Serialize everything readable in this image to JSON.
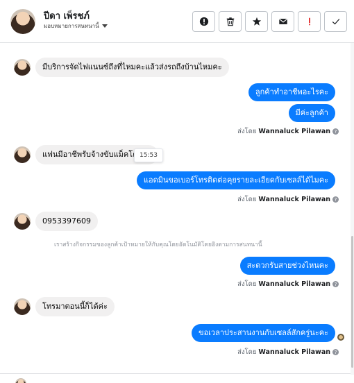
{
  "header": {
    "contact_name": "ปีดา เพ็รชภ์",
    "assign_label": "มอบหมายการสนทนานี้",
    "actions": [
      {
        "icon": "exclamation-circle-icon"
      },
      {
        "icon": "trash-icon"
      },
      {
        "icon": "star-icon"
      },
      {
        "icon": "envelope-icon"
      },
      {
        "icon": "alert-icon",
        "color": "#e02020"
      },
      {
        "icon": "check-icon"
      }
    ]
  },
  "colors": {
    "outgoing_bubble": "#0a7cff",
    "incoming_bubble": "#f1f0f0"
  },
  "messages": [
    {
      "dir": "in",
      "text": "มีบริการจัดไฟแนนซ์ถึงที่ไหมคะแล้วส่งรถถึงบ้านไหมคะ"
    },
    {
      "dir": "out",
      "text": "ลูกค้าทำอาชีพอะไรคะ"
    },
    {
      "dir": "out",
      "text": "มีค่ะลูกค้า"
    },
    {
      "dir": "in",
      "text": "แฟนมีอาชีพรับจ้างขับแม็คโครค่ะ"
    },
    {
      "dir": "out",
      "text": "แอดมินขอเบอร์โทรติดต่อคุยรายละเอียดกับเซลล์ได้ไมคะ"
    },
    {
      "dir": "in",
      "text": "0953397609"
    },
    {
      "dir": "out",
      "text": "สะดวกรับสายช่วงไหนคะ"
    },
    {
      "dir": "in",
      "text": "โทรมาตอนนี้ก็ได้ค่ะ"
    },
    {
      "dir": "out",
      "text": "ขอเวลาประสานงานกับเซลล์สักครู่นะคะ"
    }
  ],
  "sent_by": {
    "prefix": "ส่งโดย",
    "name": "Wannaluck Pilawan"
  },
  "tooltip_time": "15:53",
  "notice": "เราสร้างกิจกรรมของลูกค้าเป้าหมายให้กับคุณโดยอัตโนมัติโดยอิงตามการสนทนานี้"
}
